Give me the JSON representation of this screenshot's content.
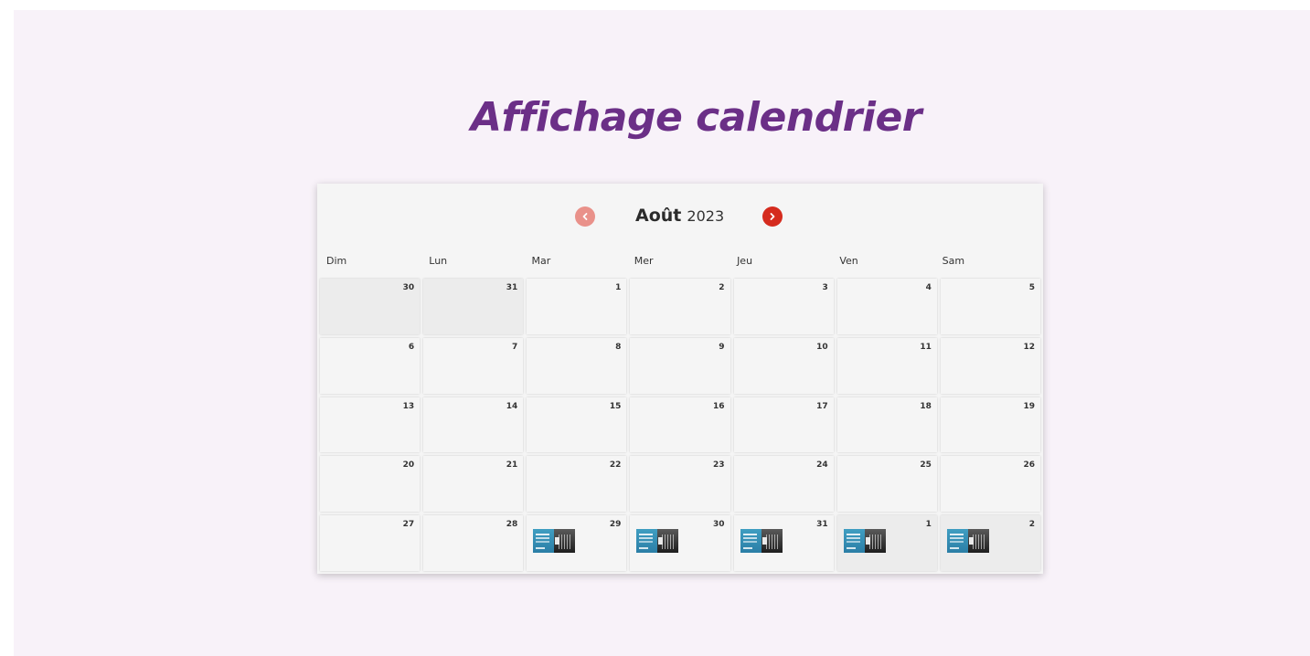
{
  "page": {
    "title": "Affichage calendrier"
  },
  "calendar": {
    "month": "Août",
    "year": "2023",
    "prev_icon": "chevron-left-icon",
    "next_icon": "chevron-right-icon",
    "colors": {
      "title": "#6b2f87",
      "prev_button": "#e9918a",
      "next_button": "#d52b1e",
      "background": "#f8f2f9"
    },
    "weekdays": [
      "Dim",
      "Lun",
      "Mar",
      "Mer",
      "Jeu",
      "Ven",
      "Sam"
    ],
    "weeks": [
      [
        {
          "day": "30",
          "other_month": true,
          "has_event": false
        },
        {
          "day": "31",
          "other_month": true,
          "has_event": false
        },
        {
          "day": "1",
          "other_month": false,
          "has_event": false
        },
        {
          "day": "2",
          "other_month": false,
          "has_event": false
        },
        {
          "day": "3",
          "other_month": false,
          "has_event": false
        },
        {
          "day": "4",
          "other_month": false,
          "has_event": false
        },
        {
          "day": "5",
          "other_month": false,
          "has_event": false
        }
      ],
      [
        {
          "day": "6",
          "other_month": false,
          "has_event": false
        },
        {
          "day": "7",
          "other_month": false,
          "has_event": false
        },
        {
          "day": "8",
          "other_month": false,
          "has_event": false
        },
        {
          "day": "9",
          "other_month": false,
          "has_event": false
        },
        {
          "day": "10",
          "other_month": false,
          "has_event": false
        },
        {
          "day": "11",
          "other_month": false,
          "has_event": false
        },
        {
          "day": "12",
          "other_month": false,
          "has_event": false
        }
      ],
      [
        {
          "day": "13",
          "other_month": false,
          "has_event": false
        },
        {
          "day": "14",
          "other_month": false,
          "has_event": false
        },
        {
          "day": "15",
          "other_month": false,
          "has_event": false
        },
        {
          "day": "16",
          "other_month": false,
          "has_event": false
        },
        {
          "day": "17",
          "other_month": false,
          "has_event": false
        },
        {
          "day": "18",
          "other_month": false,
          "has_event": false
        },
        {
          "day": "19",
          "other_month": false,
          "has_event": false
        }
      ],
      [
        {
          "day": "20",
          "other_month": false,
          "has_event": false
        },
        {
          "day": "21",
          "other_month": false,
          "has_event": false
        },
        {
          "day": "22",
          "other_month": false,
          "has_event": false
        },
        {
          "day": "23",
          "other_month": false,
          "has_event": false
        },
        {
          "day": "24",
          "other_month": false,
          "has_event": false
        },
        {
          "day": "25",
          "other_month": false,
          "has_event": false
        },
        {
          "day": "26",
          "other_month": false,
          "has_event": false
        }
      ],
      [
        {
          "day": "27",
          "other_month": false,
          "has_event": false
        },
        {
          "day": "28",
          "other_month": false,
          "has_event": false
        },
        {
          "day": "29",
          "other_month": false,
          "has_event": true
        },
        {
          "day": "30",
          "other_month": false,
          "has_event": true
        },
        {
          "day": "31",
          "other_month": false,
          "has_event": true
        },
        {
          "day": "1",
          "other_month": true,
          "has_event": true
        },
        {
          "day": "2",
          "other_month": true,
          "has_event": true
        }
      ]
    ]
  }
}
